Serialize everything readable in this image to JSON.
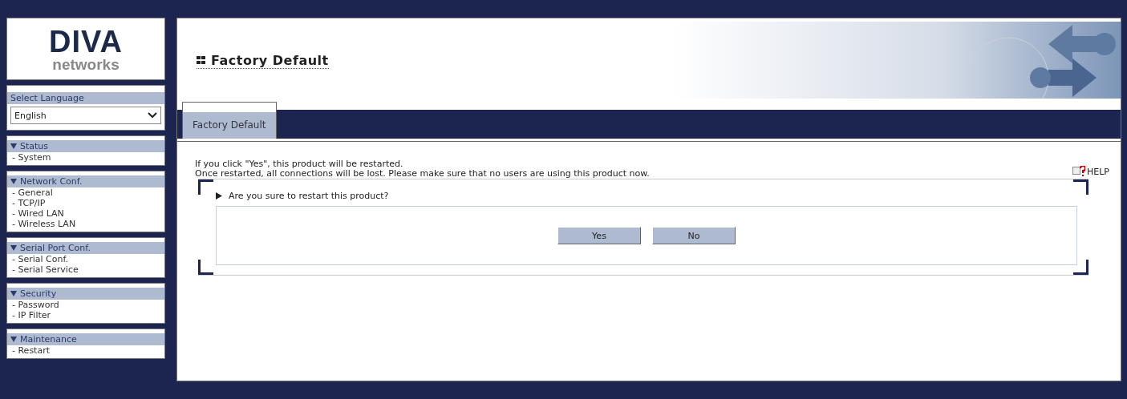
{
  "sidebar": {
    "logo": {
      "title": "DIVA",
      "subtitle": "networks"
    },
    "language": {
      "label": "Select Language",
      "value": "English"
    },
    "groups": [
      {
        "title": "Status",
        "items": [
          "- System"
        ]
      },
      {
        "title": "Network Conf.",
        "items": [
          "- General",
          "- TCP/IP",
          "- Wired LAN",
          "- Wireless LAN"
        ]
      },
      {
        "title": "Serial Port Conf.",
        "items": [
          "- Serial Conf.",
          "- Serial Service"
        ]
      },
      {
        "title": "Security",
        "items": [
          "- Password",
          "- IP Filter"
        ]
      },
      {
        "title": "Maintenance",
        "items": [
          "- Restart"
        ]
      }
    ]
  },
  "main": {
    "page_title": "Factory Default",
    "tabs": [
      {
        "label": "Factory Default",
        "selected": true
      }
    ],
    "messages": [
      "If you click \"Yes\", this product will be restarted.",
      "Once restarted, all connections will be lost. Please make sure that no users are using this product now."
    ],
    "help": "HELP",
    "question": "Are you sure to restart this product?",
    "buttons": [
      "Yes",
      "No"
    ]
  }
}
